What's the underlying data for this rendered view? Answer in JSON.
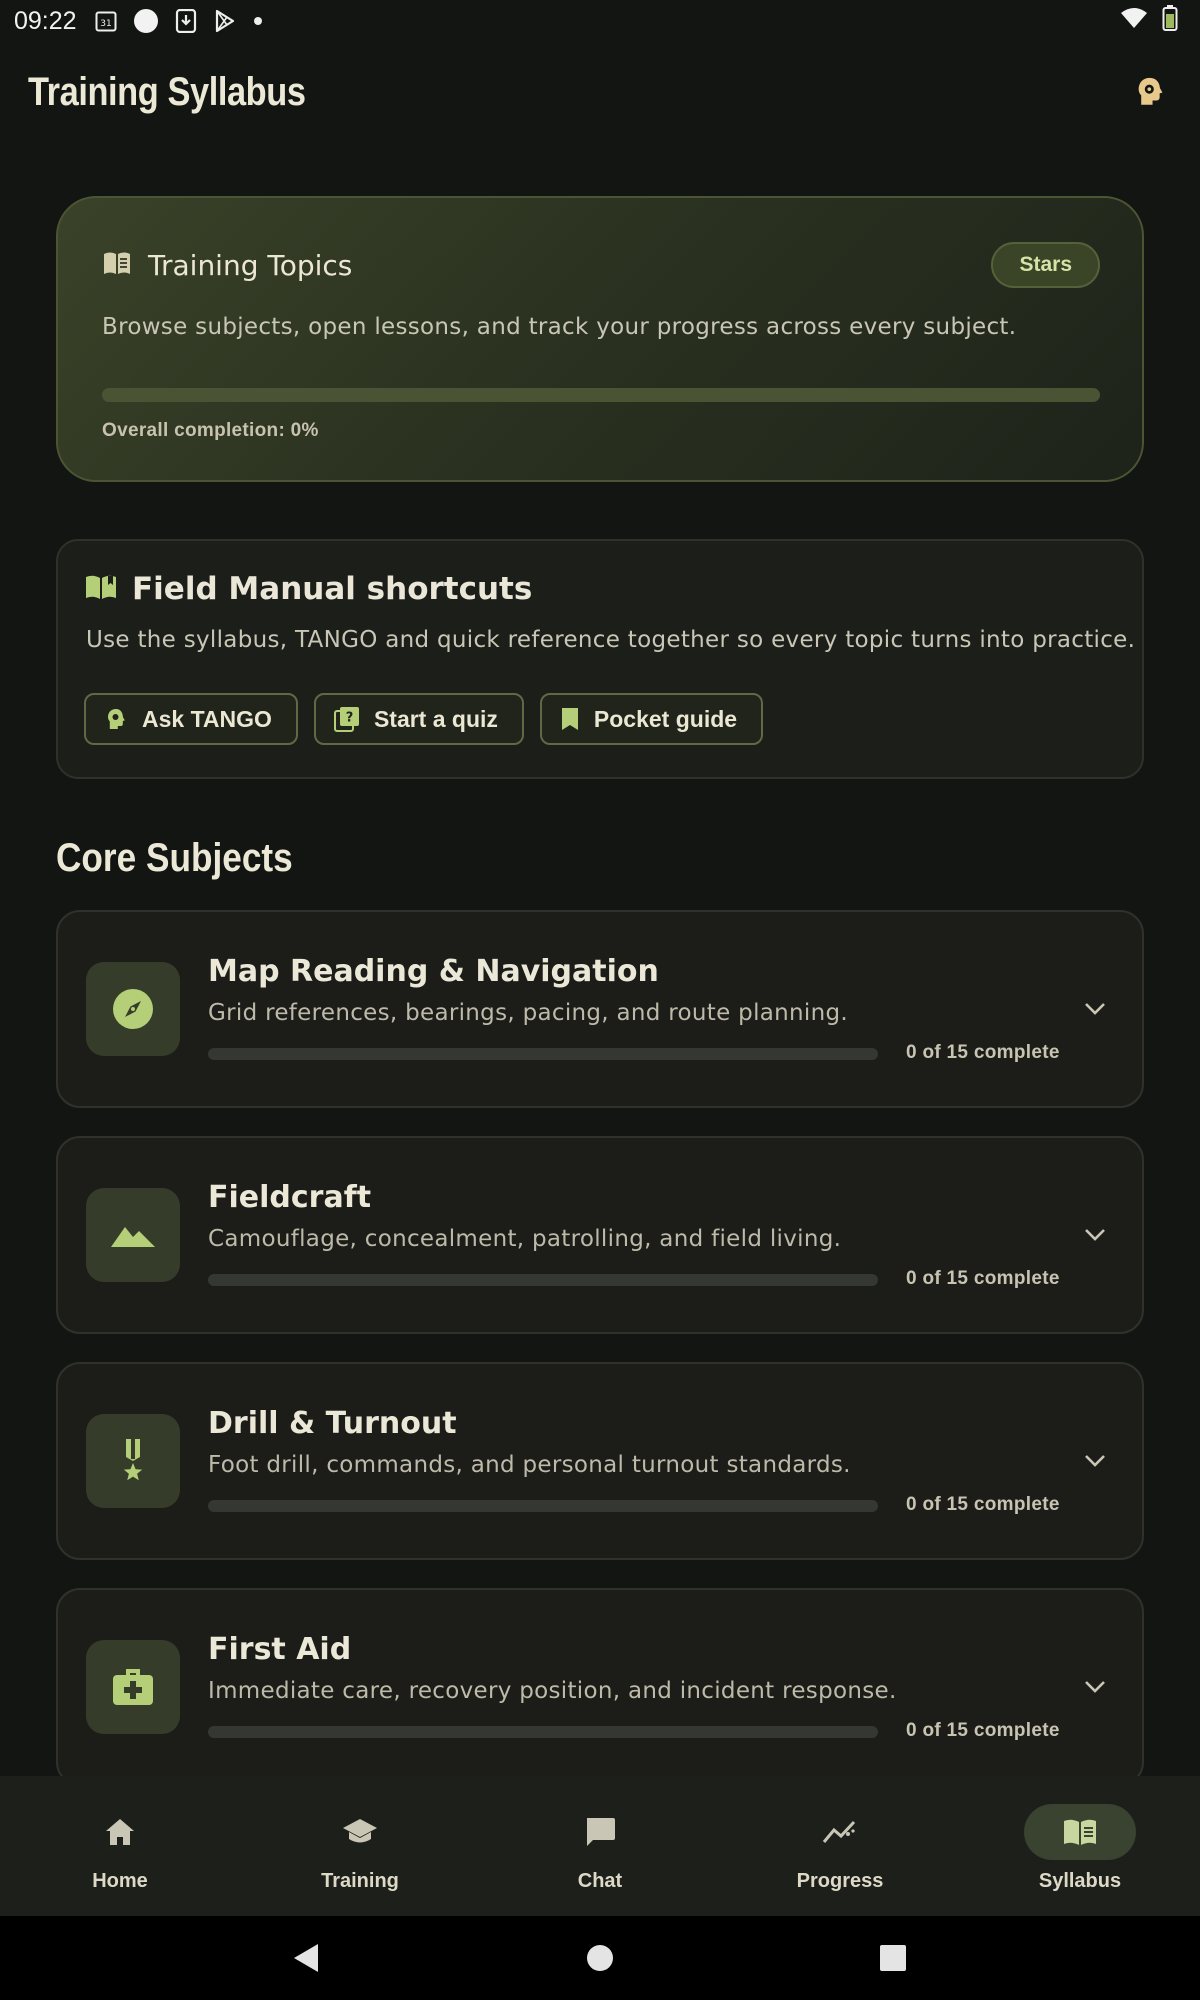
{
  "status_bar": {
    "time": "09:22",
    "calendar_day": "31"
  },
  "app_bar": {
    "title": "Training Syllabus"
  },
  "hero": {
    "title": "Training Topics",
    "badge": "Stars",
    "description": "Browse subjects, open lessons, and track your progress across every subject.",
    "progress_fraction": 0,
    "completion_label": "Overall completion: 0%"
  },
  "shortcuts": {
    "title": "Field Manual shortcuts",
    "description": "Use the syllabus, TANGO and quick reference together so every topic turns into practice.",
    "buttons": [
      {
        "label": "Ask TANGO",
        "icon": "brain-icon"
      },
      {
        "label": "Start a quiz",
        "icon": "quiz-icon"
      },
      {
        "label": "Pocket guide",
        "icon": "bookmark-icon"
      }
    ]
  },
  "section_heading": "Core Subjects",
  "subjects": [
    {
      "title": "Map Reading & Navigation",
      "description": "Grid references, bearings, pacing, and route planning.",
      "progress_fraction": 0,
      "count": "0 of 15 complete",
      "icon": "compass-icon"
    },
    {
      "title": "Fieldcraft",
      "description": "Camouflage, concealment, patrolling, and field living.",
      "progress_fraction": 0,
      "count": "0 of 15 complete",
      "icon": "terrain-icon"
    },
    {
      "title": "Drill & Turnout",
      "description": "Foot drill, commands, and personal turnout standards.",
      "progress_fraction": 0,
      "count": "0 of 15 complete",
      "icon": "medal-icon"
    },
    {
      "title": "First Aid",
      "description": "Immediate care, recovery position, and incident response.",
      "progress_fraction": 0,
      "count": "0 of 15 complete",
      "icon": "medical-kit-icon"
    }
  ],
  "bottom_nav": [
    {
      "label": "Home",
      "icon": "home-icon",
      "active": false
    },
    {
      "label": "Training",
      "icon": "school-icon",
      "active": false
    },
    {
      "label": "Chat",
      "icon": "chat-icon",
      "active": false
    },
    {
      "label": "Progress",
      "icon": "trend-icon",
      "active": false
    },
    {
      "label": "Syllabus",
      "icon": "book-icon",
      "active": true
    }
  ],
  "colors": {
    "accent": "#a6c262",
    "background": "#131513",
    "card": "#1c1d19",
    "hero_top": "#3a4229"
  }
}
